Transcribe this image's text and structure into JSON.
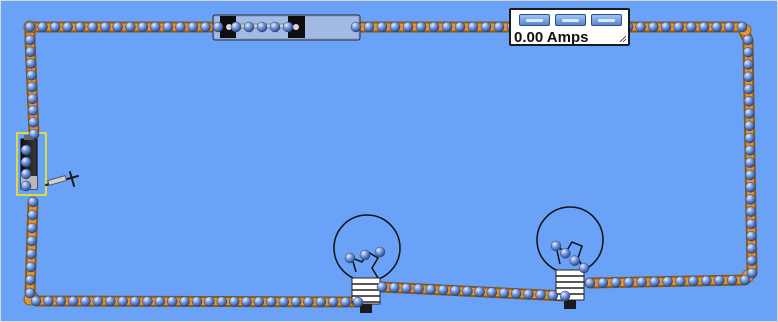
{
  "colors": {
    "background": "#6aa2f8",
    "wire": "#e4952e",
    "wire_outline": "#8a5a1a",
    "electron": "#5a7fc4",
    "battery_highlight": "#ffee00"
  },
  "ammeter": {
    "readout": "0.00 Amps"
  },
  "components": [
    "battery-icon",
    "switch-icon",
    "light-bulb-icon",
    "ammeter-icon"
  ]
}
